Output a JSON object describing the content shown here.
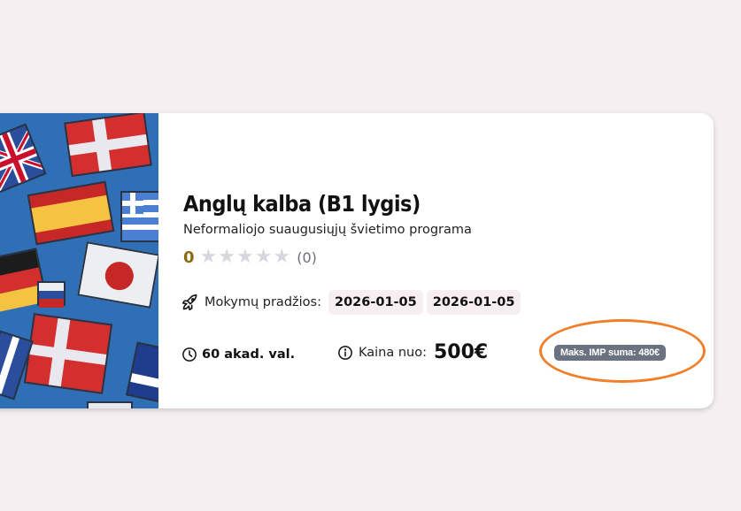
{
  "course": {
    "title": "Anglų kalba (B1 lygis)",
    "subtitle": "Neformaliojo suaugusiųjų švietimo programa",
    "rating": {
      "score": "0",
      "count": "(0)",
      "stars_filled": 0,
      "stars_total": 5
    },
    "start": {
      "label": "Mokymų pradžios:",
      "dates": [
        "2026-01-05",
        "2026-01-05"
      ]
    },
    "hours": "60 akad. val.",
    "price": {
      "label": "Kaina nuo:",
      "value": "500€"
    },
    "imp_badge": "Maks. IMP suma: 480€"
  },
  "icons": {
    "start": "rocket-icon",
    "hours": "clock-icon",
    "price": "info-icon",
    "rating": "star-icon"
  },
  "colors": {
    "background": "#f5eff1",
    "card": "#ffffff",
    "score": "#8a6b13",
    "star_empty": "#d5d8de",
    "date_chip": "#f6eef0",
    "badge": "#6b7280",
    "highlight": "#f07f28"
  }
}
